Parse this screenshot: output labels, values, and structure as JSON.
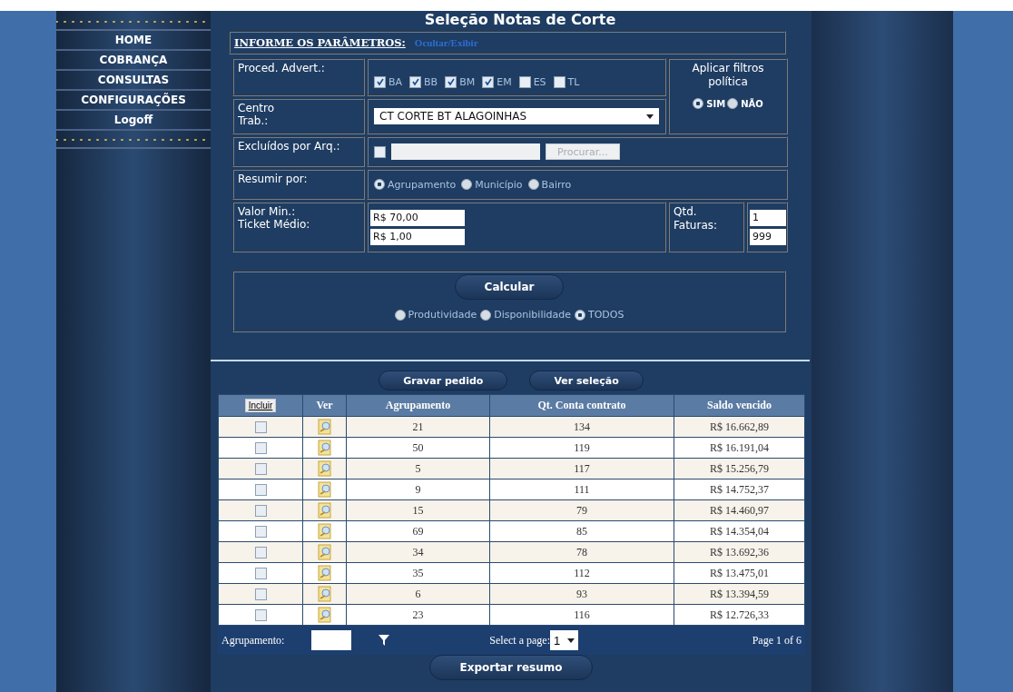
{
  "sidebar": {
    "items": [
      {
        "label": "HOME"
      },
      {
        "label": "COBRANÇA"
      },
      {
        "label": "CONSULTAS"
      },
      {
        "label": "CONFIGURAÇÕES"
      },
      {
        "label": "Logoff"
      }
    ]
  },
  "page_title": "Seleção Notas de Corte",
  "params": {
    "heading": "INFORME OS PARÂMETROS:",
    "toggle_link": "Ocultar/Exibir",
    "proced": {
      "label": "Proced. Advert.:",
      "options": [
        {
          "label": "BA",
          "checked": true
        },
        {
          "label": "BB",
          "checked": true
        },
        {
          "label": "BM",
          "checked": true
        },
        {
          "label": "EM",
          "checked": true
        },
        {
          "label": "ES",
          "checked": false
        },
        {
          "label": "TL",
          "checked": false
        }
      ]
    },
    "centro": {
      "label": "Centro Trab.:",
      "value": "CT CORTE BT ALAGOINHAS"
    },
    "filtros": {
      "label": "Aplicar filtros política",
      "options": [
        {
          "label": "SIM",
          "selected": true
        },
        {
          "label": "NÃO",
          "selected": false
        }
      ]
    },
    "excluidos": {
      "label": "Excluídos por Arq.:",
      "checked": false,
      "browse_button": "Procurar..."
    },
    "resumir": {
      "label": "Resumir por:",
      "options": [
        {
          "label": "Agrupamento",
          "selected": true
        },
        {
          "label": "Município",
          "selected": false
        },
        {
          "label": "Bairro",
          "selected": false
        }
      ]
    },
    "valor_min": {
      "label": "Valor Min.:",
      "value": "R$ 70,00"
    },
    "ticket": {
      "label": "Ticket Médio:",
      "value": "R$ 1,00"
    },
    "qtd": {
      "label": "Qtd. Faturas:",
      "min": "1",
      "max": "999"
    }
  },
  "calc": {
    "button": "Calcular",
    "options": [
      {
        "label": "Produtividade",
        "selected": false
      },
      {
        "label": "Disponibilidade",
        "selected": false
      },
      {
        "label": "TODOS",
        "selected": true
      }
    ]
  },
  "actions": [
    "Gravar pedido",
    "Ver seleção"
  ],
  "table": {
    "include_button": "Incluir",
    "columns": [
      "Ver",
      "Agrupamento",
      "Qt. Conta contrato",
      "Saldo vencido"
    ],
    "rows": [
      {
        "checked": false,
        "agrupamento": "21",
        "qt": "134",
        "saldo": "R$ 16.662,89"
      },
      {
        "checked": false,
        "agrupamento": "50",
        "qt": "119",
        "saldo": "R$ 16.191,04"
      },
      {
        "checked": false,
        "agrupamento": "5",
        "qt": "117",
        "saldo": "R$ 15.256,79"
      },
      {
        "checked": false,
        "agrupamento": "9",
        "qt": "111",
        "saldo": "R$ 14.752,37"
      },
      {
        "checked": false,
        "agrupamento": "15",
        "qt": "79",
        "saldo": "R$ 14.460,97"
      },
      {
        "checked": false,
        "agrupamento": "69",
        "qt": "85",
        "saldo": "R$ 14.354,04"
      },
      {
        "checked": false,
        "agrupamento": "34",
        "qt": "78",
        "saldo": "R$ 13.692,36"
      },
      {
        "checked": false,
        "agrupamento": "35",
        "qt": "112",
        "saldo": "R$ 13.475,01"
      },
      {
        "checked": false,
        "agrupamento": "6",
        "qt": "93",
        "saldo": "R$ 13.394,59"
      },
      {
        "checked": false,
        "agrupamento": "23",
        "qt": "116",
        "saldo": "R$ 12.726,33"
      }
    ]
  },
  "footer": {
    "filter_label": "Agrupamento:",
    "page_label": "Select a page:",
    "page_value": "1",
    "page_info": "Page 1 of 6"
  },
  "export_button": "Exportar resumo"
}
